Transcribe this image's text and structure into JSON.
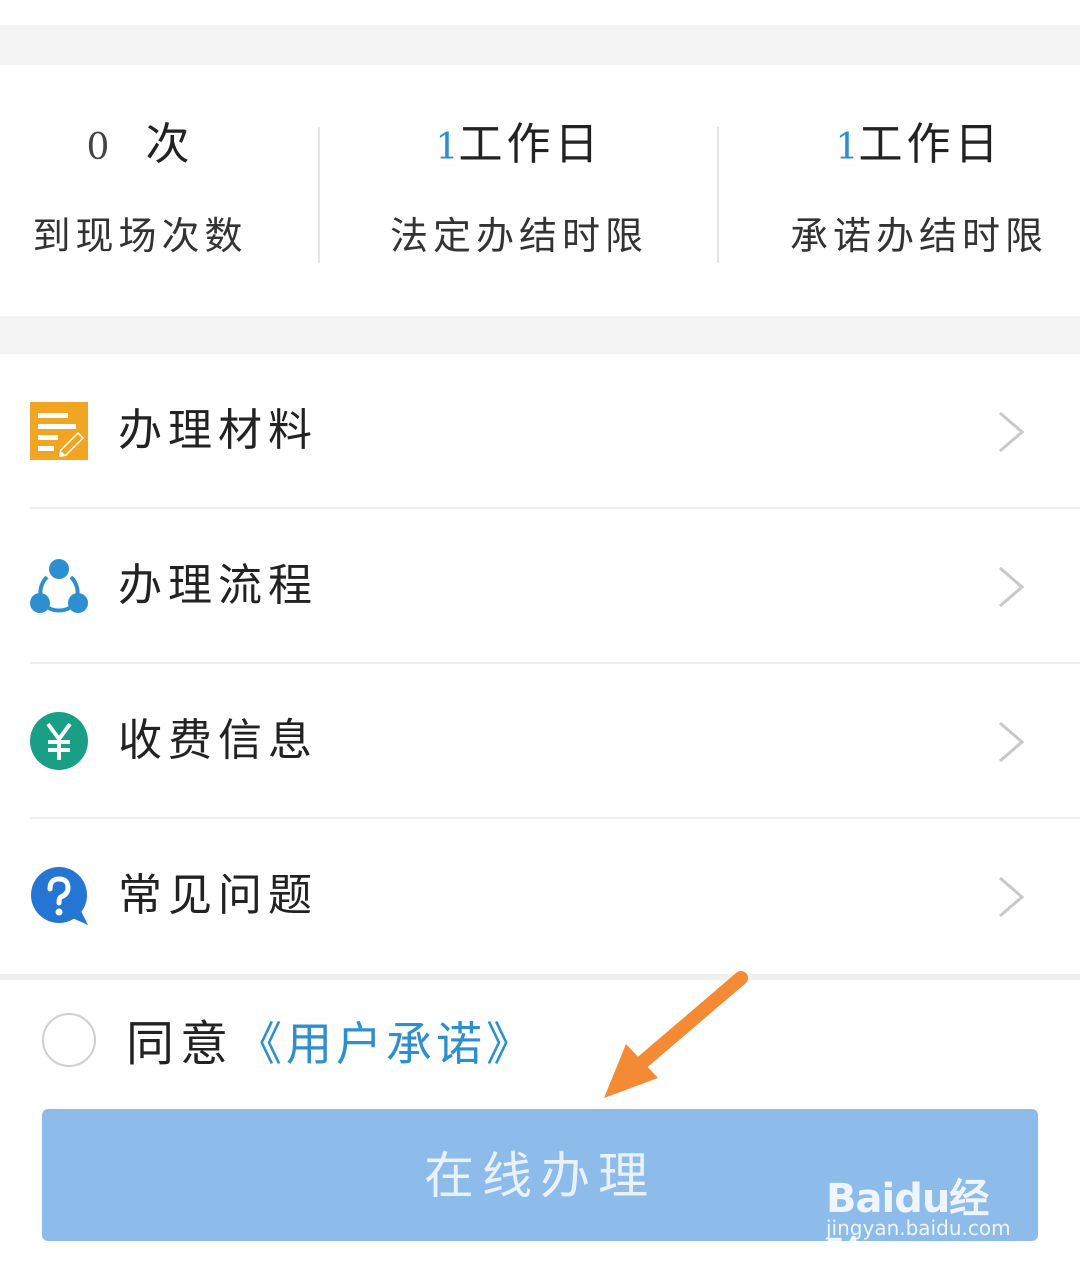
{
  "stats": [
    {
      "number": "0",
      "unit": " 次",
      "label": "到现场次数"
    },
    {
      "number": "1",
      "unit": "工作日",
      "label": "法定办结时限"
    },
    {
      "number": "1",
      "unit": "工作日",
      "label": "承诺办结时限"
    }
  ],
  "menu": {
    "items": [
      {
        "label": "办理材料",
        "icon": "document-edit-icon"
      },
      {
        "label": "办理流程",
        "icon": "process-nodes-icon"
      },
      {
        "label": "收费信息",
        "icon": "yen-icon"
      },
      {
        "label": "常见问题",
        "icon": "question-icon"
      }
    ]
  },
  "agreement": {
    "prefix": "同意",
    "link_text": "《用户承诺》",
    "checked": false
  },
  "submit_button": {
    "label": "在线办理"
  },
  "watermark": {
    "logo_text": "Baidu经验",
    "url": "jingyan.baidu.com"
  },
  "colors": {
    "accent": "#2d8fd0",
    "button_bg": "#8dbcea",
    "arrow": "#f58a34",
    "doc_icon": "#f0a623",
    "process_icon": "#2d8fd0",
    "yen_icon": "#1a9f87",
    "question_icon": "#2576d2"
  }
}
